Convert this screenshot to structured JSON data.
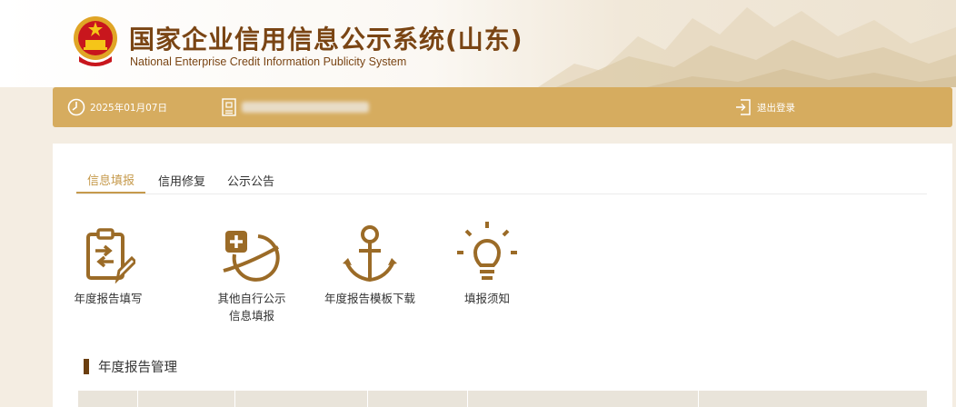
{
  "header": {
    "title_cn": "国家企业信用信息公示系统(山东)",
    "title_en": "National Enterprise Credit Information Publicity System",
    "emblem_icon": "national-emblem-icon"
  },
  "topbar": {
    "date": "2025年01月07日",
    "logout_label": "退出登录",
    "bg_color": "#d6ac5f"
  },
  "tabs": [
    {
      "label": "信息填报",
      "active": true
    },
    {
      "label": "信用修复",
      "active": false
    },
    {
      "label": "公示公告",
      "active": false
    }
  ],
  "functions": [
    {
      "label": "年度报告填写",
      "icon": "annual-report-clipboard-icon"
    },
    {
      "label": "其他自行公示信息填报",
      "icon": "planet-plus-icon"
    },
    {
      "label": "年度报告模板下载",
      "icon": "anchor-icon"
    },
    {
      "label": "填报须知",
      "icon": "lightbulb-icon"
    }
  ],
  "section": {
    "title": "年度报告管理"
  },
  "colors": {
    "accent": "#c69a4c",
    "title_brown": "#7a4514",
    "icon_brown": "#9b6b27",
    "page_bg": "#f4ede2"
  }
}
